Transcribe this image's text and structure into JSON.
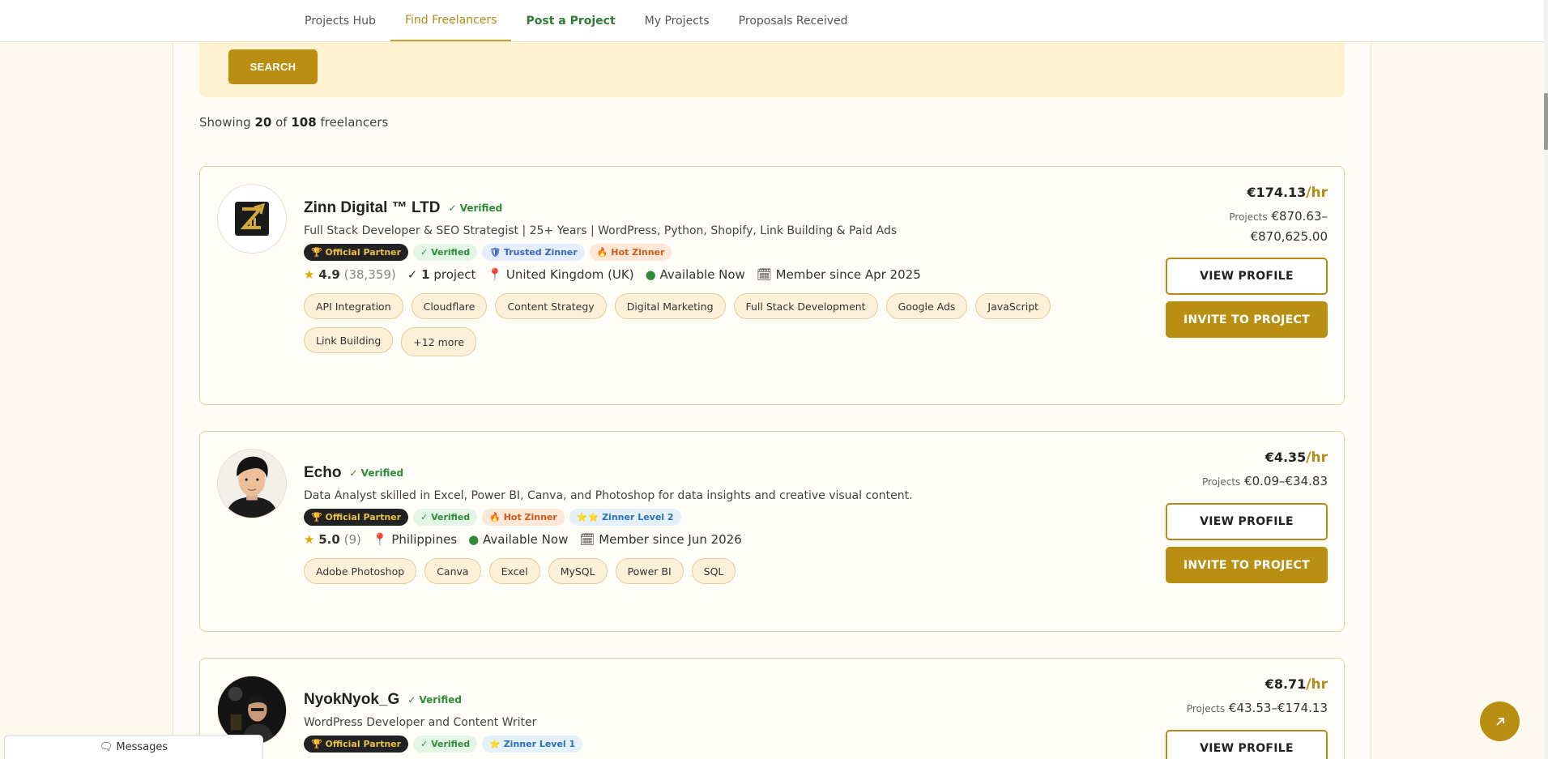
{
  "nav": {
    "items": [
      {
        "label": "Projects Hub"
      },
      {
        "label": "Find Freelancers"
      },
      {
        "label": "Post a Project"
      },
      {
        "label": "My Projects"
      },
      {
        "label": "Proposals Received"
      }
    ]
  },
  "search": {
    "button_label": "SEARCH"
  },
  "results": {
    "prefix": "Showing",
    "shown": "20",
    "of_word": "of",
    "total": "108",
    "suffix": "freelancers"
  },
  "freelancers": [
    {
      "name": "Zinn Digital ™ LTD",
      "verified": "✓ Verified",
      "headline": "Full Stack Developer & SEO Strategist | 25+ Years | WordPress, Python, Shopify, Link Building & Paid Ads",
      "badges": [
        "🏆 Official Partner",
        "✓ Verified",
        "🛡 Trusted Zinner",
        "🔥 Hot Zinner"
      ],
      "rating": "4.9",
      "reviews": "(38,359)",
      "projects_done": "1",
      "projects_done_suffix": "project",
      "location": "United Kingdom (UK)",
      "availability": "Available Now",
      "member_since": "Member since Apr 2025",
      "skills": [
        "API Integration",
        "Cloudflare",
        "Content Strategy",
        "Digital Marketing",
        "Full Stack Development",
        "Google Ads",
        "JavaScript",
        "Link Building",
        "+12 more"
      ],
      "rate": "€174.13",
      "rate_unit": "/hr",
      "projects_label": "Projects",
      "projects_range_line1": "€870.63–",
      "projects_range_line2": "€870,625.00",
      "view_label": "VIEW PROFILE",
      "invite_label": "INVITE TO PROJECT"
    },
    {
      "name": "Echo",
      "verified": "✓ Verified",
      "headline": "Data Analyst skilled in Excel, Power BI, Canva, and Photoshop for data insights and creative visual content.",
      "badges": [
        "🏆 Official Partner",
        "✓ Verified",
        "🔥 Hot Zinner",
        "⭐⭐ Zinner Level 2"
      ],
      "rating": "5.0",
      "reviews": "(9)",
      "location": "Philippines",
      "availability": "Available Now",
      "member_since": "Member since Jun 2026",
      "skills": [
        "Adobe Photoshop",
        "Canva",
        "Excel",
        "MySQL",
        "Power BI",
        "SQL"
      ],
      "rate": "€4.35",
      "rate_unit": "/hr",
      "projects_label": "Projects",
      "projects_range": "€0.09–€34.83",
      "view_label": "VIEW PROFILE",
      "invite_label": "INVITE TO PROJECT"
    },
    {
      "name": "NyokNyok_G",
      "verified": "✓ Verified",
      "headline": "WordPress Developer and Content Writer",
      "badges": [
        "🏆 Official Partner",
        "✓ Verified",
        "⭐ Zinner Level 1"
      ],
      "rate": "€8.71",
      "rate_unit": "/hr",
      "projects_label": "Projects",
      "projects_range": "€43.53–€174.13",
      "view_label": "VIEW PROFILE"
    }
  ],
  "messages": {
    "label": "Messages"
  },
  "colors": {
    "accent": "#b98f12",
    "verified": "#2e8b3a",
    "background": "#fdf9ee"
  }
}
